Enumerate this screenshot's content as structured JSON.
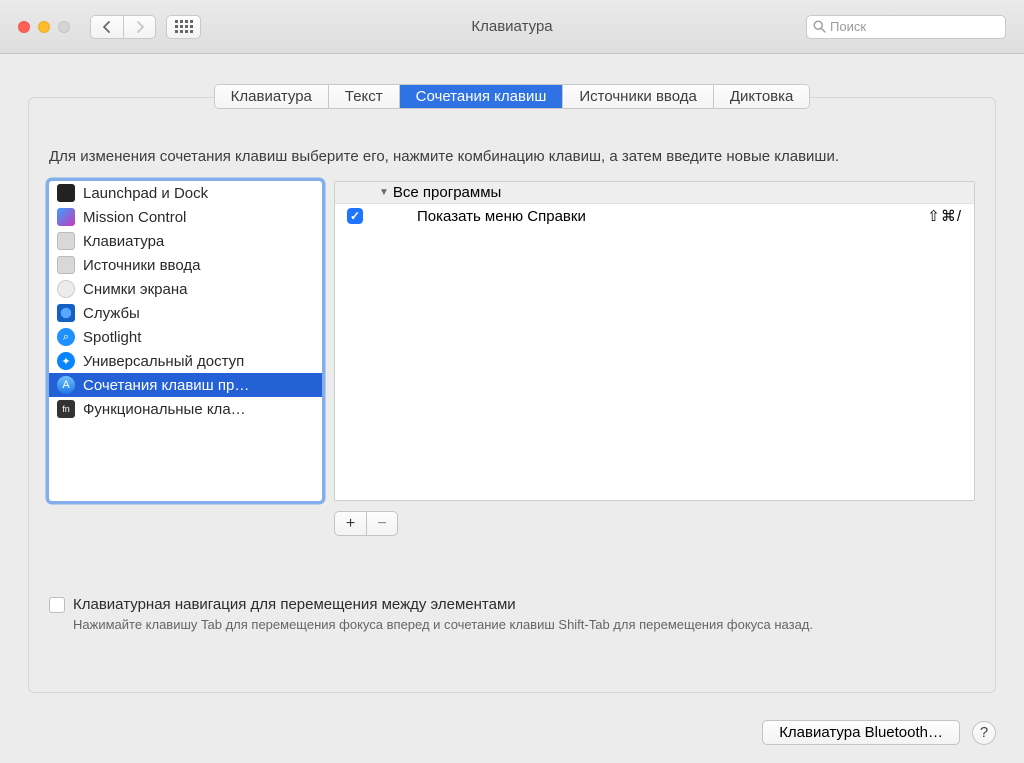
{
  "window": {
    "title": "Клавиатура",
    "search_placeholder": "Поиск"
  },
  "tabs": [
    {
      "label": "Клавиатура",
      "selected": false
    },
    {
      "label": "Текст",
      "selected": false
    },
    {
      "label": "Сочетания клавиш",
      "selected": true
    },
    {
      "label": "Источники ввода",
      "selected": false
    },
    {
      "label": "Диктовка",
      "selected": false
    }
  ],
  "hint": "Для изменения сочетания клавиш выберите его, нажмите комбинацию клавиш, а затем введите новые клавиши.",
  "categories": [
    {
      "label": "Launchpad и Dock",
      "icon": "launchpad-icon",
      "selected": false
    },
    {
      "label": "Mission Control",
      "icon": "mission-control-icon",
      "selected": false
    },
    {
      "label": "Клавиатура",
      "icon": "keyboard-icon",
      "selected": false
    },
    {
      "label": "Источники ввода",
      "icon": "input-source-icon",
      "selected": false
    },
    {
      "label": "Снимки экрана",
      "icon": "screenshot-icon",
      "selected": false
    },
    {
      "label": "Службы",
      "icon": "services-icon",
      "selected": false
    },
    {
      "label": "Spotlight",
      "icon": "spotlight-icon",
      "selected": false
    },
    {
      "label": "Универсальный доступ",
      "icon": "accessibility-icon",
      "selected": false
    },
    {
      "label": "Сочетания клавиш пр…",
      "icon": "appstore-icon",
      "selected": true
    },
    {
      "label": "Функциональные кла…",
      "icon": "fn-icon",
      "selected": false
    }
  ],
  "group_header": "Все программы",
  "shortcuts": [
    {
      "enabled": true,
      "label": "Показать меню Справки",
      "keys": "⇧⌘/"
    }
  ],
  "plus_label": "+",
  "minus_label": "−",
  "keyboard_nav": {
    "checked": false,
    "label": "Клавиатурная навигация для перемещения между элементами",
    "sub": "Нажимайте клавишу Tab для перемещения фокуса вперед и сочетание клавиш Shift-Tab для перемещения фокуса назад."
  },
  "bluetooth_btn": "Клавиатура Bluetooth…",
  "help": "?"
}
